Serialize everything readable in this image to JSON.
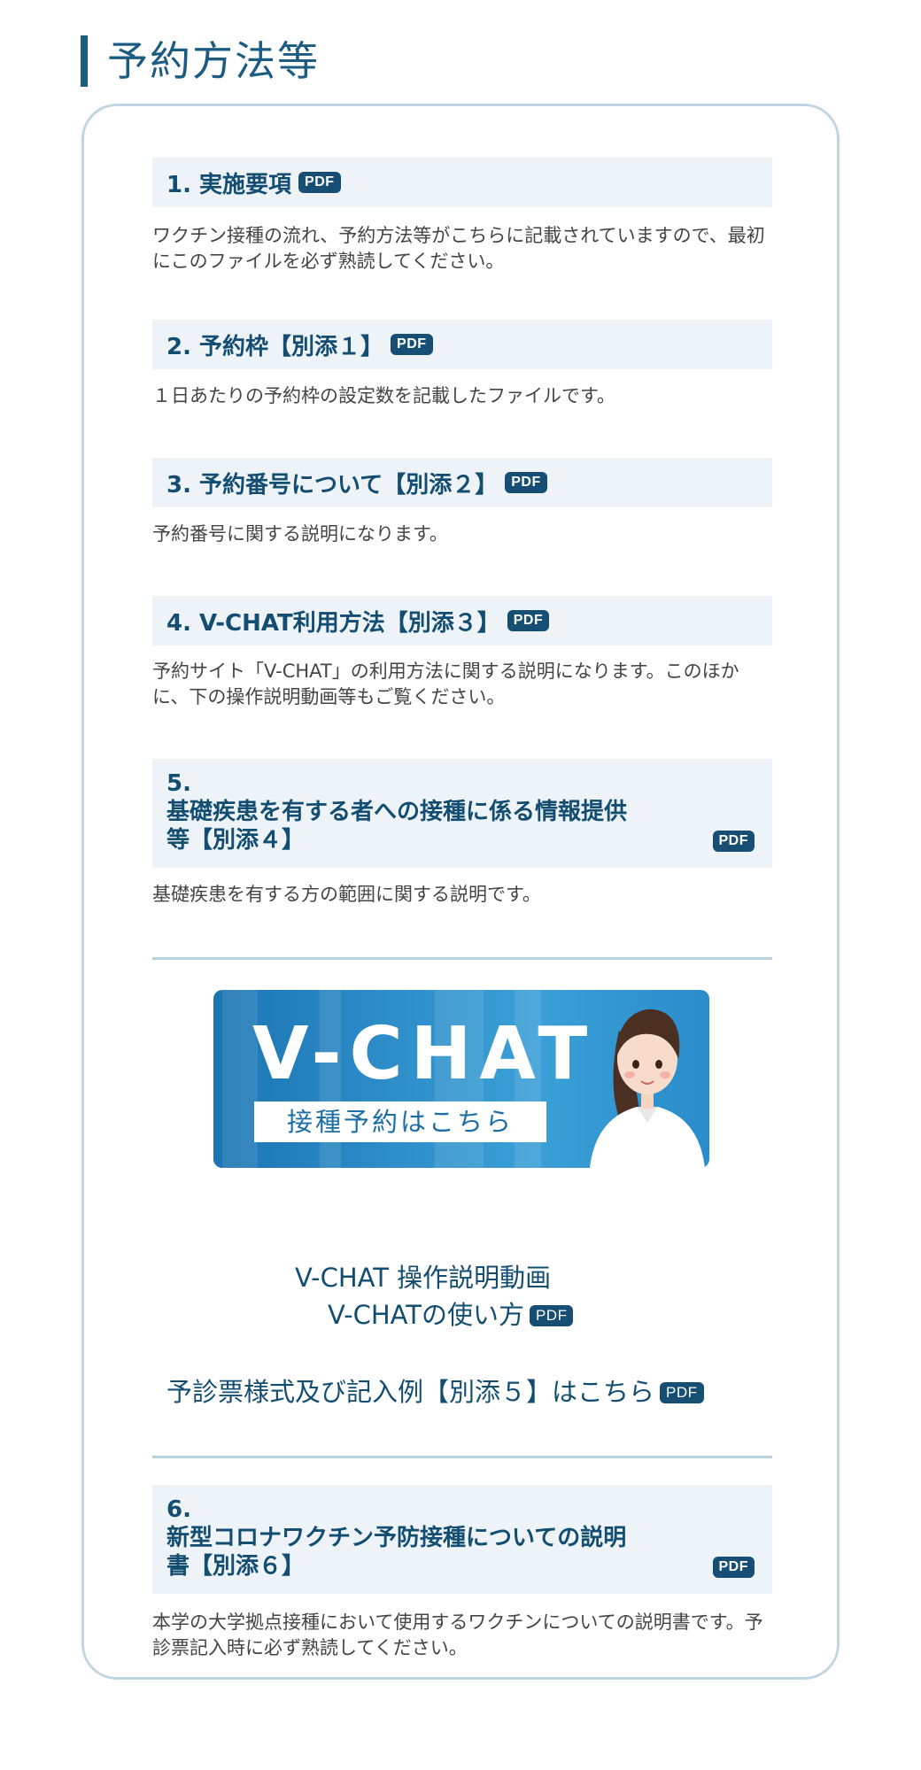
{
  "section_title": "予約方法等",
  "pdf_label": "PDF",
  "items": [
    {
      "heading": "1. 実施要項",
      "description": "ワクチン接種の流れ、予約方法等がこちらに記載されていますので、最初にこのファイルを必ず熟読してください。"
    },
    {
      "heading": "2. 予約枠【別添１】",
      "description": "１日あたりの予約枠の設定数を記載したファイルです。"
    },
    {
      "heading": "3. 予約番号について【別添２】",
      "description": "予約番号に関する説明になります。"
    },
    {
      "heading": "4. V-CHAT利用方法【別添３】",
      "description": "予約サイト「V-CHAT」の利用方法に関する説明になります。このほかに、下の操作説明動画等もご覧ください。"
    },
    {
      "heading_number": "5.",
      "heading_line1": "基礎疾患を有する者への接種に係る情報提供",
      "heading_line2": "等【別添４】",
      "description": "基礎疾患を有する方の範囲に関する説明です。"
    },
    {
      "heading_number": "6.",
      "heading_line1": "新型コロナワクチン予防接種についての説明",
      "heading_line2": "書【別添６】",
      "description": "本学の大学拠点接種において使用するワクチンについての説明書です。予診票記入時に必ず熟読してください。"
    }
  ],
  "banner": {
    "title": "V-CHAT",
    "subtitle": "接種予約はこちら"
  },
  "links": {
    "video": "V-CHAT 操作説明動画",
    "howto": "V-CHATの使い方",
    "form": "予診票様式及び記入例【別添５】はこちら"
  }
}
